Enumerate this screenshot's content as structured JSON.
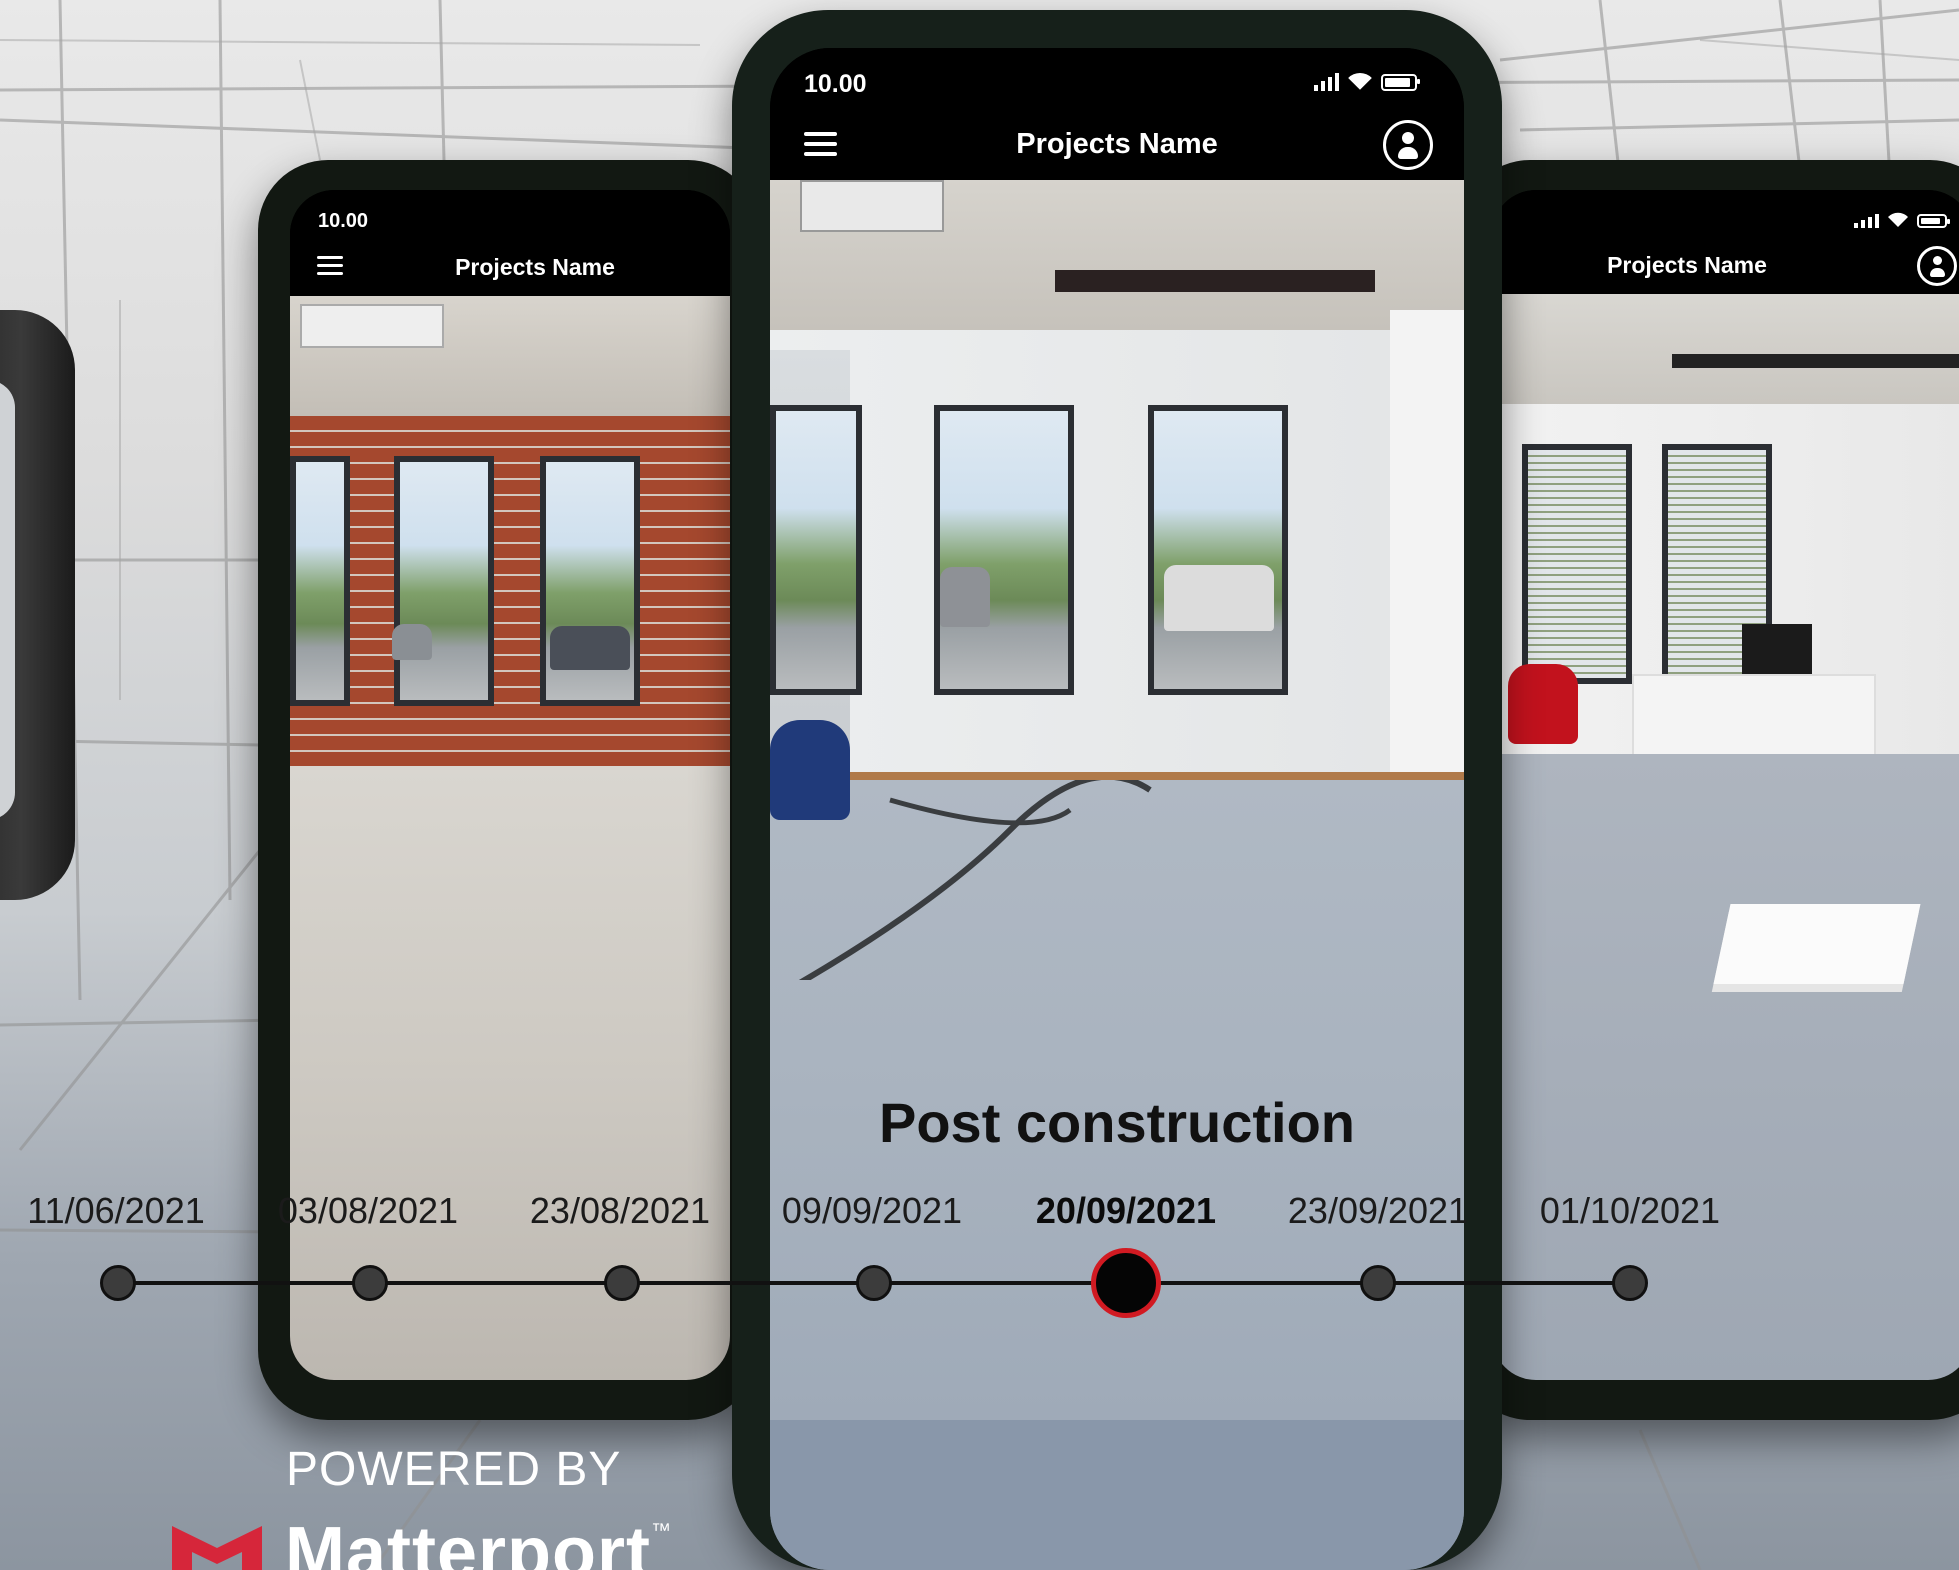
{
  "phones": {
    "left": {
      "time": "10.00",
      "title": "Projects Name"
    },
    "center": {
      "time": "10.00",
      "title": "Projects Name",
      "caption": "Post construction"
    },
    "right": {
      "title": "Projects Name"
    }
  },
  "timeline": {
    "dates": [
      "11/06/2021",
      "03/08/2021",
      "23/08/2021",
      "09/09/2021",
      "20/09/2021",
      "23/09/2021",
      "01/10/2021"
    ],
    "selected": "20/09/2021",
    "accent_color": "#d11a22"
  },
  "branding": {
    "powered_by": "POWERED BY",
    "brand": "Matterport",
    "trademark": "™",
    "brand_color": "#d6263a"
  },
  "icons": [
    "menu-icon",
    "user-icon",
    "signal-icon",
    "wifi-icon",
    "battery-icon"
  ]
}
